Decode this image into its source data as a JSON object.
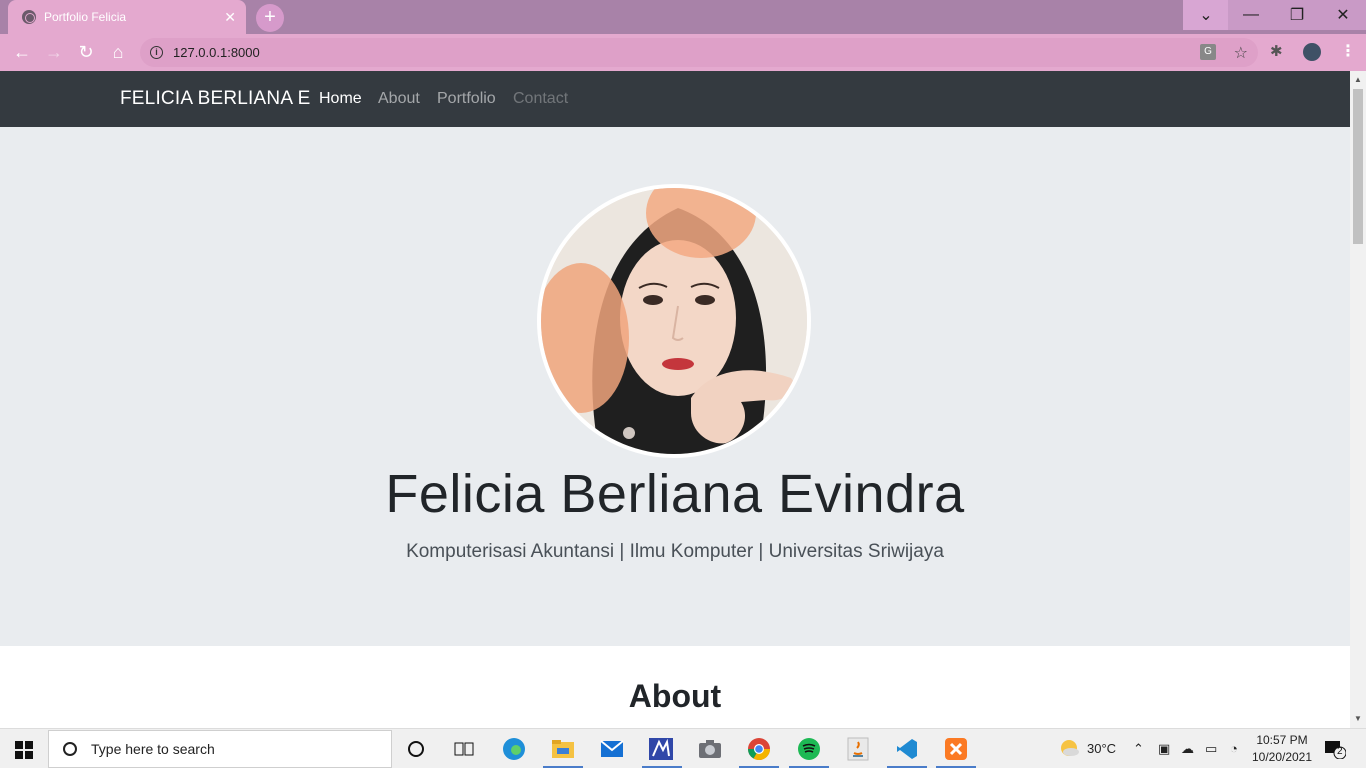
{
  "browser": {
    "tab_title": "Portfolio Felicia",
    "tab_close": "✕",
    "new_tab": "+",
    "url": "127.0.0.1:8000",
    "window_controls": {
      "dropdown": "⌄",
      "minimize": "—",
      "restore": "❐",
      "close": "✕"
    },
    "nav_buttons": {
      "back": "←",
      "forward": "→",
      "reload": "↻",
      "home": "⌂"
    }
  },
  "site": {
    "brand": "FELICIA BERLIANA E",
    "nav": [
      {
        "label": "Home",
        "state": "active"
      },
      {
        "label": "About",
        "state": "inactive"
      },
      {
        "label": "Portfolio",
        "state": "inactive"
      },
      {
        "label": "Contact",
        "state": "dim"
      }
    ],
    "hero": {
      "name": "Felicia Berliana Evindra",
      "subtitle": "Komputerisasi Akuntansi | Ilmu Komputer | Universitas Sriwijaya"
    },
    "about_heading": "About",
    "colors": {
      "navbar": "#343a40",
      "hero_bg": "#e9ecef"
    }
  },
  "taskbar": {
    "search_placeholder": "Type here to search",
    "temperature": "30°C",
    "time": "10:57 PM",
    "date": "10/20/2021",
    "notification_count": "2",
    "apps": [
      "cortana-icon",
      "task-view-icon",
      "edge-icon",
      "file-explorer-icon",
      "mail-icon",
      "app-icon",
      "camera-icon",
      "chrome-icon",
      "spotify-icon",
      "java-icon",
      "vscode-icon",
      "xampp-icon"
    ]
  }
}
